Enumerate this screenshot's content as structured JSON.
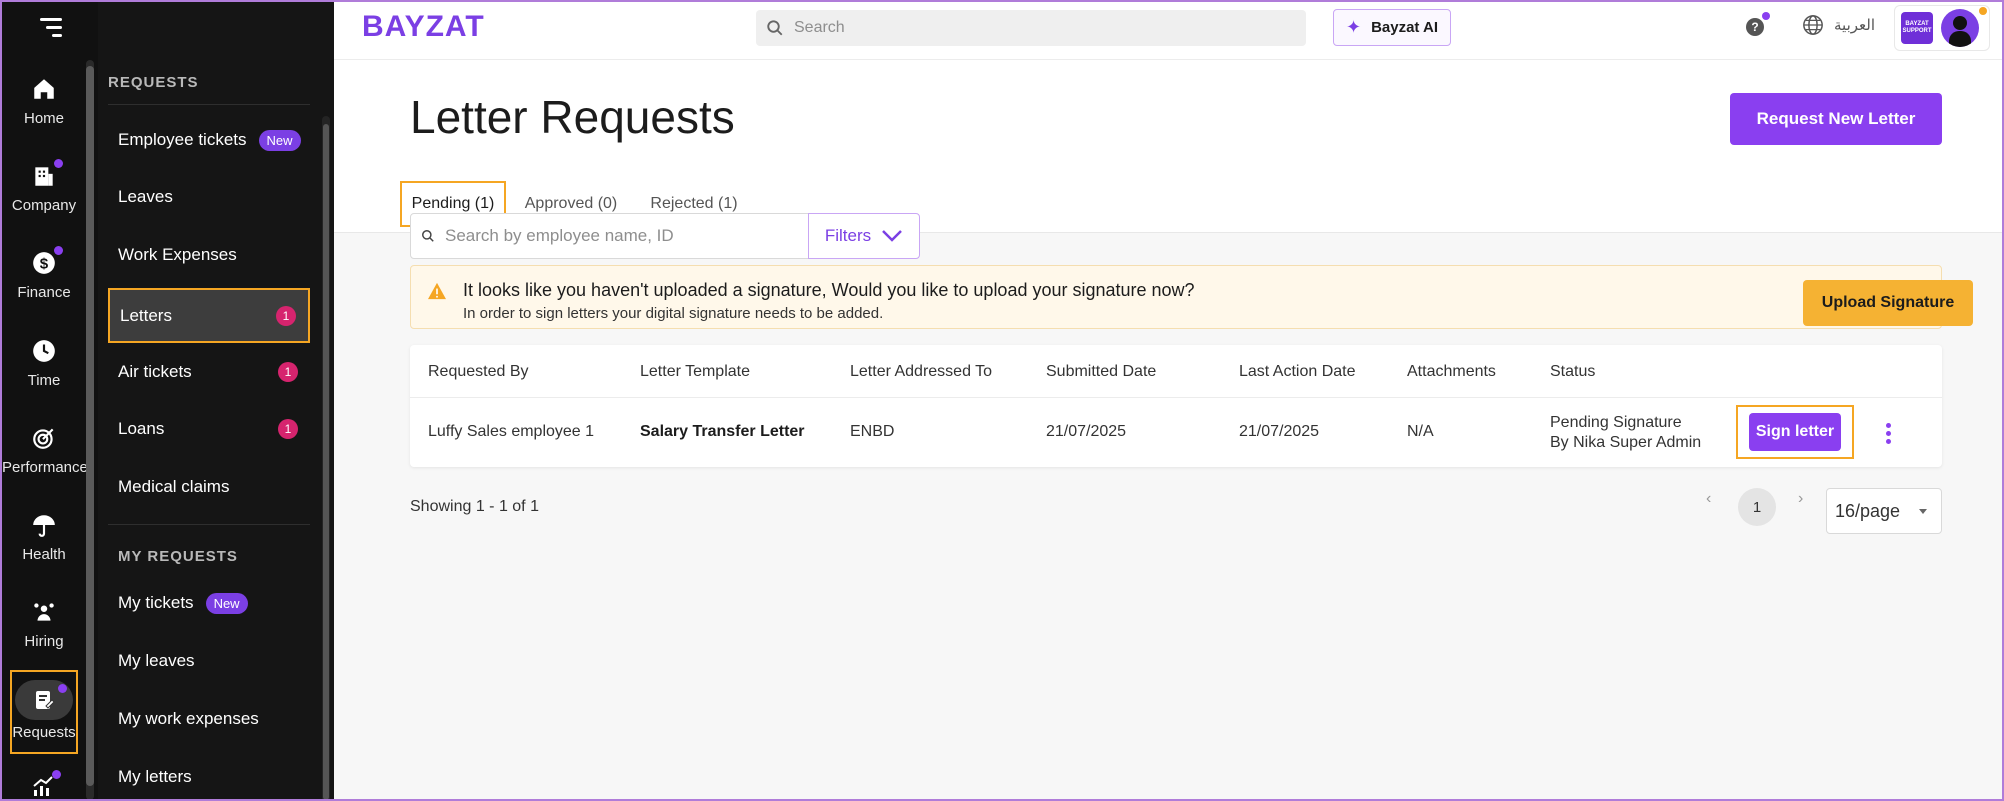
{
  "brand": {
    "logo": "BAYZAT",
    "accent": "#8a3ff0",
    "warning": "#f5b233",
    "highlight": "#f5a623"
  },
  "rail": {
    "items": [
      {
        "label": "Home",
        "icon": "home-icon"
      },
      {
        "label": "Company",
        "icon": "building-icon"
      },
      {
        "label": "Finance",
        "icon": "dollar-icon"
      },
      {
        "label": "Time",
        "icon": "clock-icon"
      },
      {
        "label": "Performance",
        "icon": "target-icon"
      },
      {
        "label": "Health",
        "icon": "umbrella-heart-icon"
      },
      {
        "label": "Hiring",
        "icon": "people-network-icon"
      },
      {
        "label": "Requests",
        "icon": "clipboard-edit-icon"
      }
    ]
  },
  "sidebar": {
    "section_requests": "REQUESTS",
    "section_my_requests": "MY REQUESTS",
    "items": [
      {
        "label": "Employee tickets",
        "badge": "New"
      },
      {
        "label": "Leaves"
      },
      {
        "label": "Work Expenses"
      },
      {
        "label": "Letters",
        "count": "1"
      },
      {
        "label": "Air tickets",
        "count": "1"
      },
      {
        "label": "Loans",
        "count": "1"
      },
      {
        "label": "Medical claims"
      }
    ],
    "my_items": [
      {
        "label": "My tickets",
        "badge": "New"
      },
      {
        "label": "My leaves"
      },
      {
        "label": "My work expenses"
      },
      {
        "label": "My letters"
      }
    ]
  },
  "header": {
    "search_placeholder": "Search",
    "ai_label": "Bayzat AI",
    "language": "العربية",
    "account_brand": "BAYZAT SUPPORT"
  },
  "main": {
    "title": "Letter Requests",
    "request_button": "Request New Letter",
    "tabs": [
      {
        "label": "Pending (1)"
      },
      {
        "label": "Approved (0)"
      },
      {
        "label": "Rejected (1)"
      }
    ],
    "search_placeholder": "Search by employee name, ID",
    "filters_label": "Filters",
    "alert": {
      "title": "It looks like you haven't uploaded a signature, Would you like to upload your signature now?",
      "subtitle": "In order to sign letters your digital signature needs to be added.",
      "button": "Upload Signature"
    },
    "table": {
      "columns": [
        "Requested By",
        "Letter Template",
        "Letter Addressed To",
        "Submitted Date",
        "Last Action Date",
        "Attachments",
        "Status"
      ],
      "rows": [
        {
          "requested_by": "Luffy Sales employee 1",
          "template": "Salary Transfer Letter",
          "addressed_to": "ENBD",
          "submitted": "21/07/2025",
          "last_action": "21/07/2025",
          "attachments": "N/A",
          "status_line1": "Pending Signature",
          "status_line2": "By Nika Super Admin",
          "action": "Sign letter"
        }
      ]
    },
    "showing": "Showing 1 - 1 of 1",
    "page": "1",
    "per_page": "16/page"
  }
}
